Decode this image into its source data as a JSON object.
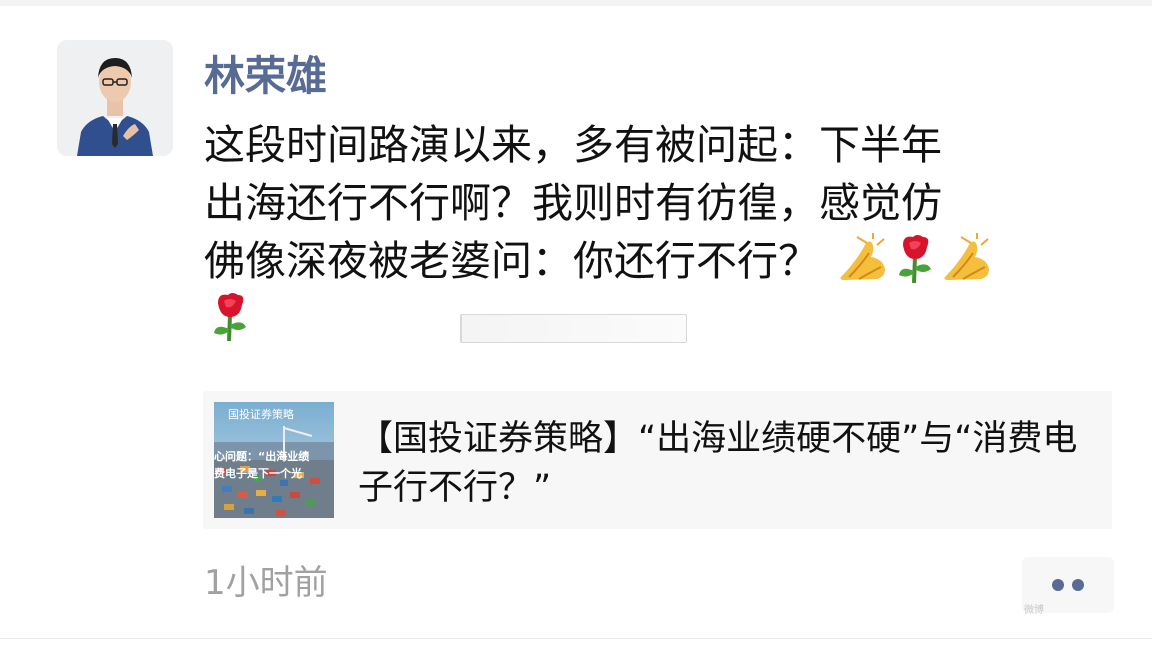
{
  "post": {
    "author_name": "林荣雄",
    "text_line1": "这段时间路演以来，多有被问起：下半年",
    "text_line2": "出海还行不行啊？我则时有彷徨，感觉仿",
    "text_line3": "佛像深夜被老婆问：你还行不行？",
    "emojis_line3": [
      "folded-hands",
      "rose",
      "folded-hands"
    ],
    "emojis_line4": [
      "rose"
    ]
  },
  "shared_link": {
    "title": "【国投证券策略】“出海业绩硬不硬”与“消费电子行不行？”",
    "thumbnail": {
      "header_text": "国投证券策略",
      "overlay_line1": "心问题：“出海业绩",
      "overlay_line2": "费电子是下一个光"
    }
  },
  "footer": {
    "timestamp": "1小时前",
    "more_icon": "two-dots-icon",
    "watermark": "微博"
  },
  "colors": {
    "author_name": "#576b95",
    "body_text": "#111111",
    "timestamp": "#a1a1a1",
    "card_background": "#f7f7f7"
  }
}
